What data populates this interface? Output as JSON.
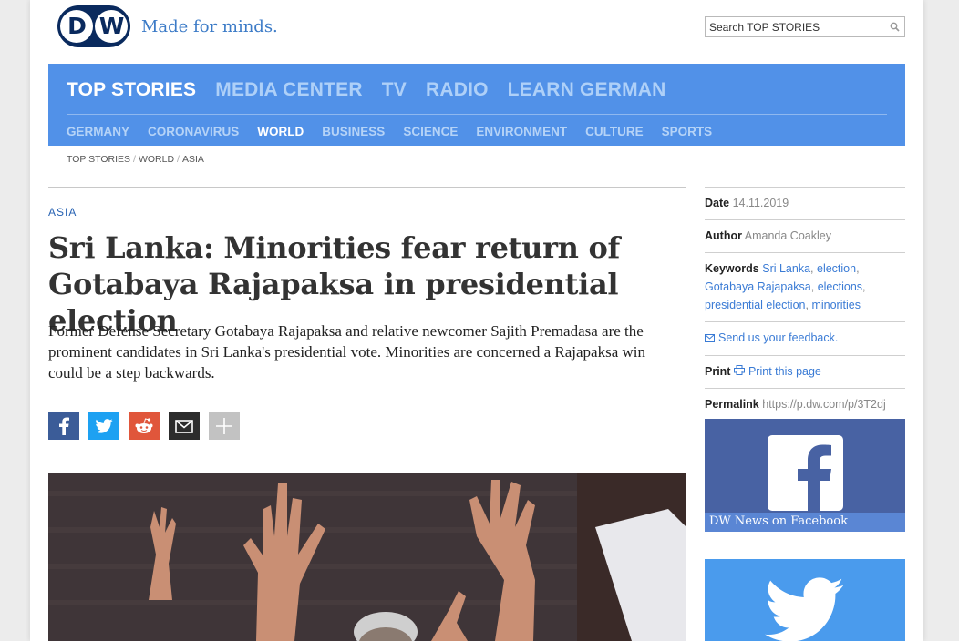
{
  "brand": {
    "logo": "DW",
    "slogan": "Made for minds."
  },
  "search": {
    "placeholder": "Search TOP STORIES"
  },
  "nav": {
    "main": [
      "TOP STORIES",
      "MEDIA CENTER",
      "TV",
      "RADIO",
      "LEARN GERMAN"
    ],
    "main_active": "TOP STORIES",
    "sub": [
      "GERMANY",
      "CORONAVIRUS",
      "WORLD",
      "BUSINESS",
      "SCIENCE",
      "ENVIRONMENT",
      "CULTURE",
      "SPORTS"
    ],
    "sub_active": "WORLD"
  },
  "breadcrumb": [
    "TOP STORIES",
    "WORLD",
    "ASIA"
  ],
  "article": {
    "kicker": "ASIA",
    "headline": "Sri Lanka: Minorities fear return of Gotabaya Rajapaksa in presidential election",
    "teaser": "Former Defense Secretary Gotabaya Rajapaksa and relative newcomer Sajith Premadasa are the prominent candidates in Sri Lanka's presidential vote. Minorities are concerned a Rajapaksa win could be a step backwards."
  },
  "share_icons": [
    "facebook-icon",
    "twitter-icon",
    "reddit-icon",
    "email-icon",
    "plus-icon"
  ],
  "info": {
    "date_label": "Date",
    "date": "14.11.2019",
    "author_label": "Author",
    "author": "Amanda Coakley",
    "keywords_label": "Keywords",
    "keywords": [
      "Sri Lanka",
      "election",
      "Gotabaya Rajapaksa",
      "elections",
      "presidential election",
      "minorities"
    ],
    "feedback": "Send us your feedback.",
    "print_label": "Print",
    "print_link": "Print this page",
    "permalink_label": "Permalink",
    "permalink": "https://p.dw.com/p/3T2dj"
  },
  "social": {
    "facebook_caption": "DW News on Facebook"
  },
  "colors": {
    "nav_bg": "#5191e8",
    "brand_navy": "#0a2a5e",
    "link": "#3a7bd5",
    "facebook": "#4862a3",
    "twitter": "#4a9bed"
  }
}
